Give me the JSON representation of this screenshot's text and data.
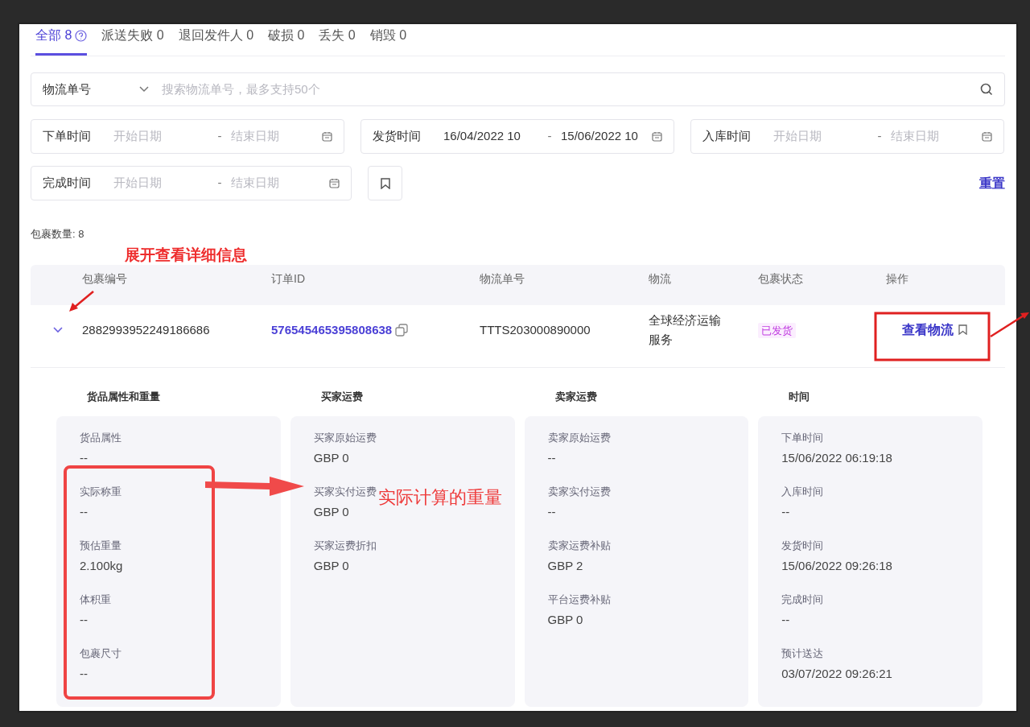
{
  "tabs": [
    {
      "label": "全部 8",
      "selected": true,
      "help": true
    },
    {
      "label": "派送失败 0",
      "selected": false,
      "help": false
    },
    {
      "label": "退回发件人 0",
      "selected": false,
      "help": false
    },
    {
      "label": "破损 0",
      "selected": false,
      "help": false
    },
    {
      "label": "丢失 0",
      "selected": false,
      "help": false
    },
    {
      "label": "销毁 0",
      "selected": false,
      "help": false
    }
  ],
  "search": {
    "type_label": "物流单号",
    "placeholder": "搜索物流单号，最多支持50个"
  },
  "date_filters": [
    {
      "label": "下单时间",
      "start_placeholder": "开始日期",
      "separator": "-",
      "end_placeholder": "结束日期"
    },
    {
      "label": "发货时间",
      "start_value": "16/04/2022 10",
      "separator": "-",
      "end_value": "15/06/2022 10"
    },
    {
      "label": "入库时间",
      "start_placeholder": "开始日期",
      "separator": "-",
      "end_placeholder": "结束日期"
    },
    {
      "label": "完成时间",
      "start_placeholder": "开始日期",
      "separator": "-",
      "end_placeholder": "结束日期"
    }
  ],
  "reset": "重置",
  "package_count": "包裹数量: 8",
  "table": {
    "columns": [
      "包裹编号",
      "订单ID",
      "物流单号",
      "物流",
      "包裹状态",
      "操作"
    ],
    "rows": [
      {
        "expanded": true,
        "package_no": "2882993952249186686",
        "order_id": "576545465395808638",
        "tracking_no": "TTTS203000890000",
        "carrier": "全球经济运输服务",
        "status": "已发货",
        "action": "查看物流",
        "details": [
          {
            "title": "货品属性和重量",
            "fields": [
              {
                "label": "货品属性",
                "value": "--"
              },
              {
                "label": "实际称重",
                "value": "--"
              },
              {
                "label": "预估重量",
                "value": "2.100kg"
              },
              {
                "label": "体积重",
                "value": "--"
              },
              {
                "label": "包裹尺寸",
                "value": "--"
              }
            ]
          },
          {
            "title": "买家运费",
            "fields": [
              {
                "label": "买家原始运费",
                "value": "GBP 0"
              },
              {
                "label": "买家实付运费",
                "value": "GBP 0"
              },
              {
                "label": "买家运费折扣",
                "value": "GBP 0"
              }
            ]
          },
          {
            "title": "卖家运费",
            "fields": [
              {
                "label": "卖家原始运费",
                "value": "--"
              },
              {
                "label": "卖家实付运费",
                "value": "--"
              },
              {
                "label": "卖家运费补贴",
                "value": "GBP 2"
              },
              {
                "label": "平台运费补贴",
                "value": "GBP 0"
              }
            ]
          },
          {
            "title": "时间",
            "fields": [
              {
                "label": "下单时间",
                "value": "15/06/2022 06:19:18"
              },
              {
                "label": "入库时间",
                "value": "--"
              },
              {
                "label": "发货时间",
                "value": "15/06/2022 09:26:18"
              },
              {
                "label": "完成时间",
                "value": "--"
              },
              {
                "label": "预计送达",
                "value": "03/07/2022 09:26:21"
              }
            ]
          }
        ]
      }
    ]
  },
  "annotations": [
    {
      "kind": "label",
      "text": "展开查看详细信息"
    },
    {
      "kind": "label",
      "text": "实际计算的重量"
    }
  ]
}
